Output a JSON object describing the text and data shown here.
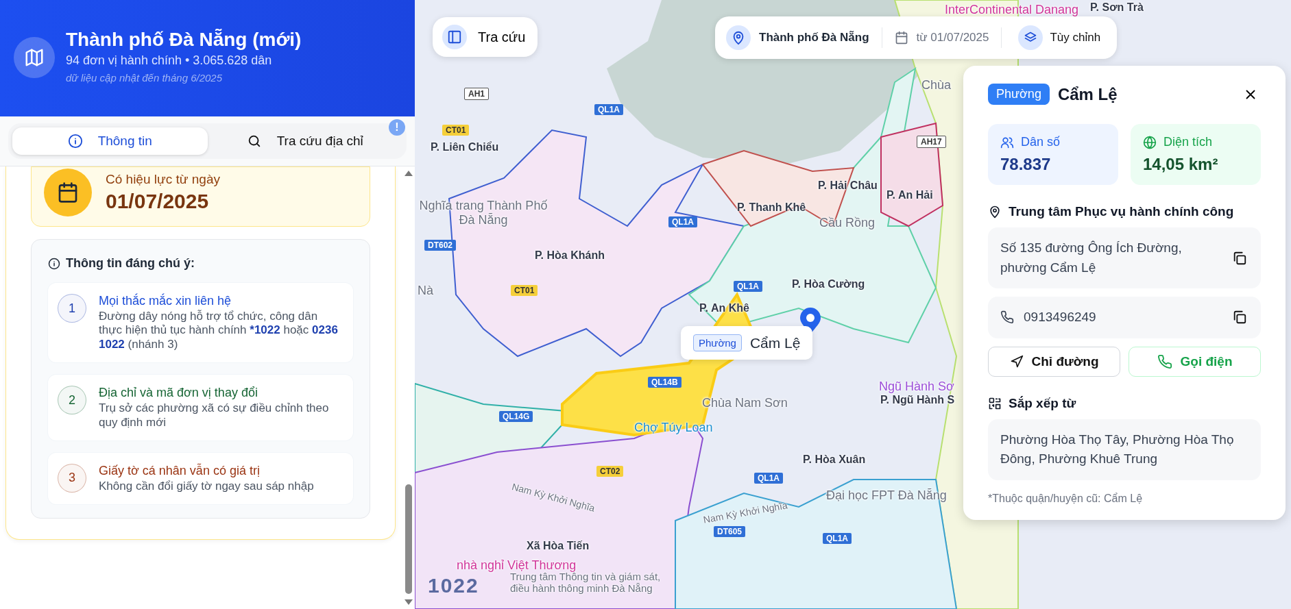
{
  "sidebar": {
    "header": {
      "title": "Thành phố Đà Nẵng (mới)",
      "subtitle": "94 đơn vị hành chính • 3.065.628 dân",
      "note": "dữ liệu cập nhật đến tháng 6/2025"
    },
    "tabs": [
      {
        "kind": "info",
        "label": "Thông tin",
        "selected": true
      },
      {
        "kind": "search",
        "label": "Tra cứu địa chỉ",
        "selected": false
      }
    ],
    "tab_badge": "!",
    "effective_date": {
      "label": "Có hiệu lực từ ngày",
      "date": "01/07/2025"
    },
    "notice": {
      "title": "Thông tin đáng chú ý:",
      "items": [
        {
          "number": "1",
          "title": "Mọi thắc mắc xin liên hệ",
          "color": "#1e40af",
          "text": [
            {
              "text": "Đường dây nóng hỗ trợ tổ chức, công dân thực hiện thủ tục hành chính ",
              "kind": "plain"
            },
            {
              "text": "*1022",
              "kind": "hotline"
            },
            {
              "text": " hoặc ",
              "kind": "plain"
            },
            {
              "text": "0236 1022",
              "kind": "hotline"
            },
            {
              "text": " (nhánh 3)",
              "kind": "plain"
            }
          ]
        },
        {
          "number": "2",
          "title": "Địa chỉ và mã đơn vị thay đổi",
          "color": "#166534",
          "text": [
            {
              "text": "Trụ sở các phường xã có sự điều chỉnh theo quy định mới",
              "kind": "plain"
            }
          ]
        },
        {
          "number": "3",
          "title": "Giấy tờ cá nhân vẫn có giá trị",
          "color": "#9a3412",
          "text": [
            {
              "text": "Không cần đổi giấy tờ ngay sau sáp nhập",
              "kind": "plain"
            }
          ]
        }
      ]
    }
  },
  "map": {
    "search_button": "Tra cứu",
    "toolbar": {
      "location": "Thành phố Đà Nẵng",
      "date": "từ 01/07/2025",
      "settings": "Tùy chỉnh"
    },
    "labels": [
      {
        "text": "P. Liên Chiểu",
        "kind": "ward"
      },
      {
        "text": "P. Hòa Khánh",
        "kind": "ward"
      },
      {
        "text": "P. Thanh Khê",
        "kind": "ward"
      },
      {
        "text": "P. Hải Châu",
        "kind": "ward"
      },
      {
        "text": "P. An Hải",
        "kind": "ward"
      },
      {
        "text": "P. Hòa Cường",
        "kind": "ward"
      },
      {
        "text": "P. An Khê",
        "kind": "ward"
      },
      {
        "text": "P. Ngũ Hành S",
        "kind": "ward"
      },
      {
        "text": "P. Hòa Xuân",
        "kind": "ward"
      },
      {
        "text": "Xã Hòa Tiến",
        "kind": "ward"
      },
      {
        "text": "Nghĩa trang Thành Phố Đà Nẵng",
        "kind": "poi"
      },
      {
        "text": "Cầu Rồng",
        "kind": "poi"
      },
      {
        "text": "Chùa Nam Sơn",
        "kind": "poi"
      },
      {
        "text": "Chùa",
        "kind": "poi"
      },
      {
        "text": "Ngũ Hành Sơ",
        "kind": "poi-purple"
      },
      {
        "text": "Đại học FPT Đà Nẵng",
        "kind": "poi"
      },
      {
        "text": "InterContinental Danang",
        "kind": "poi-pink"
      },
      {
        "text": "P. Sơn Trà",
        "kind": "ward"
      },
      {
        "text": "Chợ Túy Loan",
        "kind": "poi-blue"
      },
      {
        "text": "nhà nghỉ Việt Thương",
        "kind": "poi-pink"
      },
      {
        "text": "Trung tâm Thông tin và giám sát, điều hành thông minh Đà Nẵng",
        "kind": "poi-small"
      },
      {
        "text": "Nam Kỳ Khởi Nghĩa",
        "kind": "street"
      },
      {
        "text": "Nam Kỳ Khởi Nghĩa",
        "kind": "street"
      },
      {
        "text": "Nà",
        "kind": "poi"
      }
    ],
    "road_shields": [
      {
        "text": "AH1",
        "kind": "asian"
      },
      {
        "text": "QL1A",
        "kind": "national"
      },
      {
        "text": "CT01",
        "kind": "provincial"
      },
      {
        "text": "QL1A",
        "kind": "national"
      },
      {
        "text": "DT602",
        "kind": "national"
      },
      {
        "text": "CT01",
        "kind": "provincial"
      },
      {
        "text": "QL1A",
        "kind": "national"
      },
      {
        "text": "AH17",
        "kind": "asian"
      },
      {
        "text": "QL14B",
        "kind": "national"
      },
      {
        "text": "QL14G",
        "kind": "national"
      },
      {
        "text": "CT02",
        "kind": "provincial"
      },
      {
        "text": "DT605",
        "kind": "national"
      },
      {
        "text": "QL1A",
        "kind": "national"
      },
      {
        "text": "QL1A",
        "kind": "national"
      }
    ],
    "popup": {
      "badge": "Phường",
      "name": "Cẩm Lệ"
    },
    "logo": "1022"
  },
  "detail_panel": {
    "badge": "Phường",
    "name": "Cẩm Lệ",
    "stats": [
      {
        "kind": "population",
        "label": "Dân số",
        "value": "78.837"
      },
      {
        "kind": "area",
        "label": "Diện tích",
        "value": "14,05 km²"
      }
    ],
    "office": {
      "heading": "Trung tâm Phục vụ hành chính công",
      "address": "Số 135 đường Ông Ích Đường, phường Cẩm Lệ",
      "phone": "0913496249"
    },
    "actions": [
      {
        "kind": "directions",
        "label": "Chỉ đường"
      },
      {
        "kind": "call",
        "label": "Gọi điện"
      }
    ],
    "merged": {
      "heading": "Sắp xếp từ",
      "text": "Phường Hòa Thọ Tây, Phường Hòa Thọ Đông, Phường Khuê Trung"
    },
    "footnote": "*Thuộc quận/huyện cũ: Cẩm Lệ"
  }
}
